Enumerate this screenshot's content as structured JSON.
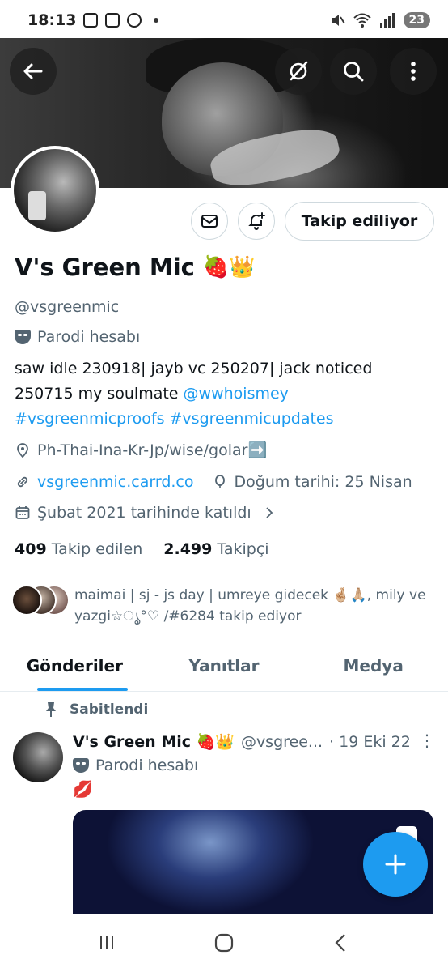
{
  "status_bar": {
    "time": "18:13",
    "battery": "23"
  },
  "profile": {
    "display_name": "V's Green Mic",
    "name_emojis": "🍓👑",
    "handle": "@vsgreenmic",
    "parody_label": "Parodi hesabı",
    "bio_text": "saw idle 230918| jayb vc 250207| jack noticed 250715 my soulmate ",
    "bio_mention": "@wwhoismey",
    "bio_hashtags": "#vsgreenmicproofs #vsgreenmicupdates",
    "location": "Ph-Thai-Ina-Kr-Jp/wise/golar➡️",
    "website": "vsgreenmic.carrd.co",
    "birthday": "Doğum tarihi: 25 Nisan",
    "joined": "Şubat 2021 tarihinde katıldı",
    "following_count": "409",
    "following_label": "Takip edilen",
    "followers_count": "2.499",
    "followers_label": "Takipçi",
    "followed_by": "maimai | sj - js day | umreye gidecek 🤞🏼🙏🏼, mily ve yazgi☆ൃ°♡ /#6284 takip ediyor",
    "follow_button": "Takip ediliyor"
  },
  "tabs": [
    {
      "label": "Gönderiler",
      "active": true
    },
    {
      "label": "Yanıtlar",
      "active": false
    },
    {
      "label": "Medya",
      "active": false
    }
  ],
  "post": {
    "pinned_label": "Sabitlendi",
    "name": "V's Green Mic 🍓👑",
    "handle": "@vsgree...",
    "date": "· 19 Eki 22",
    "parody_label": "Parodi hesabı",
    "text": "💋"
  },
  "colors": {
    "accent": "#1d9bf0",
    "secondary_text": "#536471",
    "border": "#cfd9de"
  }
}
